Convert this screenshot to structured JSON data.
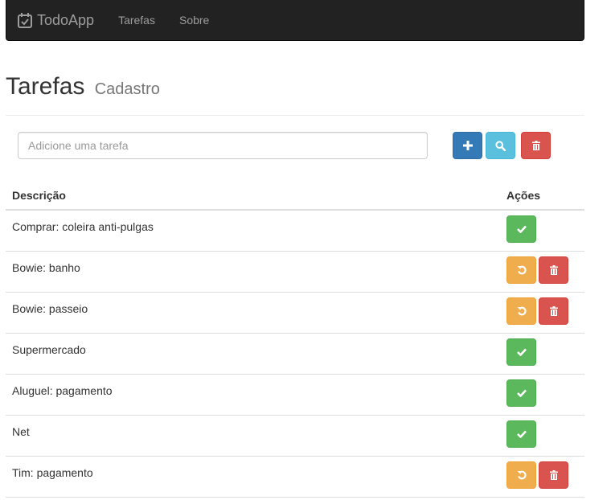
{
  "navbar": {
    "brand": "TodoApp",
    "links": [
      "Tarefas",
      "Sobre"
    ]
  },
  "header": {
    "title": "Tarefas",
    "subtitle": "Cadastro"
  },
  "form": {
    "placeholder": "Adicione uma tarefa",
    "value": ""
  },
  "table": {
    "headers": [
      "Descrição",
      "Ações"
    ],
    "rows": [
      {
        "description": "Comprar: coleira anti-pulgas",
        "done": false
      },
      {
        "description": "Bowie: banho",
        "done": true
      },
      {
        "description": "Bowie: passeio",
        "done": true
      },
      {
        "description": "Supermercado",
        "done": false
      },
      {
        "description": "Aluguel: pagamento",
        "done": false
      },
      {
        "description": "Net",
        "done": false
      },
      {
        "description": "Tim: pagamento",
        "done": true
      }
    ]
  },
  "colors": {
    "primary": "#337ab7",
    "info": "#5bc0de",
    "danger": "#d9534f",
    "success": "#5cb85c",
    "warning": "#f0ad4e"
  }
}
